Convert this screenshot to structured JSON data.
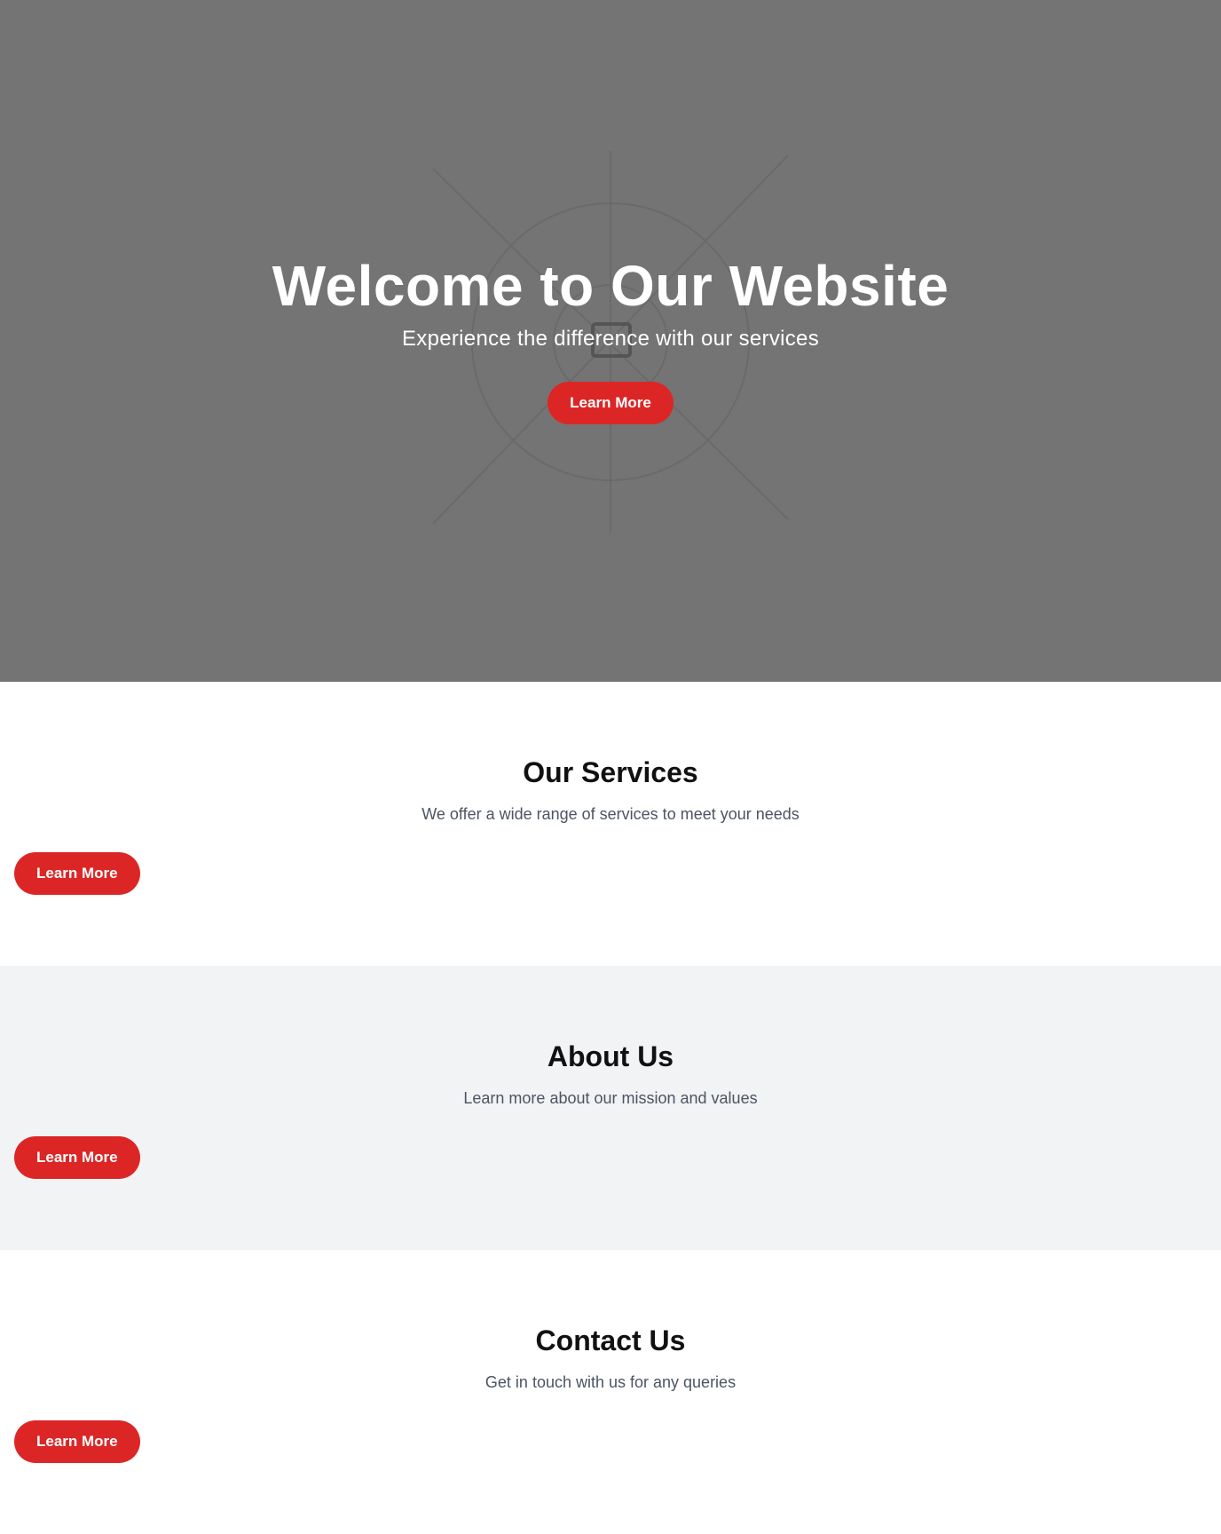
{
  "hero": {
    "title": "Welcome to Our Website",
    "subtitle": "Experience the difference with our services",
    "button_label": "Learn More",
    "background_color": "#747474"
  },
  "sections": [
    {
      "title": "Our Services",
      "description": "We offer a wide range of services to meet your needs",
      "button_label": "Learn More"
    },
    {
      "title": "About Us",
      "description": "Learn more about our mission and values",
      "button_label": "Learn More"
    },
    {
      "title": "Contact Us",
      "description": "Get in touch with us for any queries",
      "button_label": "Learn More"
    }
  ],
  "colors": {
    "accent": "#dc2626",
    "alt_section_bg": "#f2f3f5",
    "muted_text": "#4b5563"
  }
}
